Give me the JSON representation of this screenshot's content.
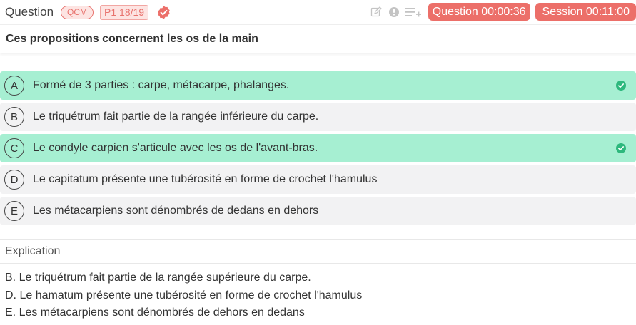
{
  "header": {
    "title": "Question",
    "type_badge": "QCM",
    "source_badge": "P1 18/19",
    "question_timer": "Question 00:00:36",
    "session_timer": "Session 00:11:00",
    "icons": [
      "edit-icon",
      "report-icon",
      "add-to-playlist-icon"
    ]
  },
  "question": {
    "text": "Ces propositions concernent les os de la main"
  },
  "answers": [
    {
      "letter": "A",
      "text": "Formé de 3 parties : carpe, métacarpe, phalanges.",
      "correct": true
    },
    {
      "letter": "B",
      "text": "Le triquétrum fait partie de la rangée inférieure du carpe.",
      "correct": false
    },
    {
      "letter": "C",
      "text": "Le condyle carpien s'articule avec les os de l'avant-bras.",
      "correct": true
    },
    {
      "letter": "D",
      "text": "Le capitatum présente une tubérosité en forme de crochet l'hamulus",
      "correct": false
    },
    {
      "letter": "E",
      "text": "Les métacarpiens sont dénombrés de dedans en dehors",
      "correct": false
    }
  ],
  "explication": {
    "title": "Explication",
    "lines": [
      "B. Le triquétrum fait partie de la rangée supérieure du carpe.",
      "D. Le hamatum présente une tubérosité en forme de crochet l'hamulus",
      "E. Les métacarpiens sont dénombrés de dehors en dedans"
    ]
  },
  "colors": {
    "accent": "#ec6f69",
    "correct_bg": "#a6efd2",
    "incorrect_bg": "#f2f2f3",
    "check": "#2db87d"
  }
}
